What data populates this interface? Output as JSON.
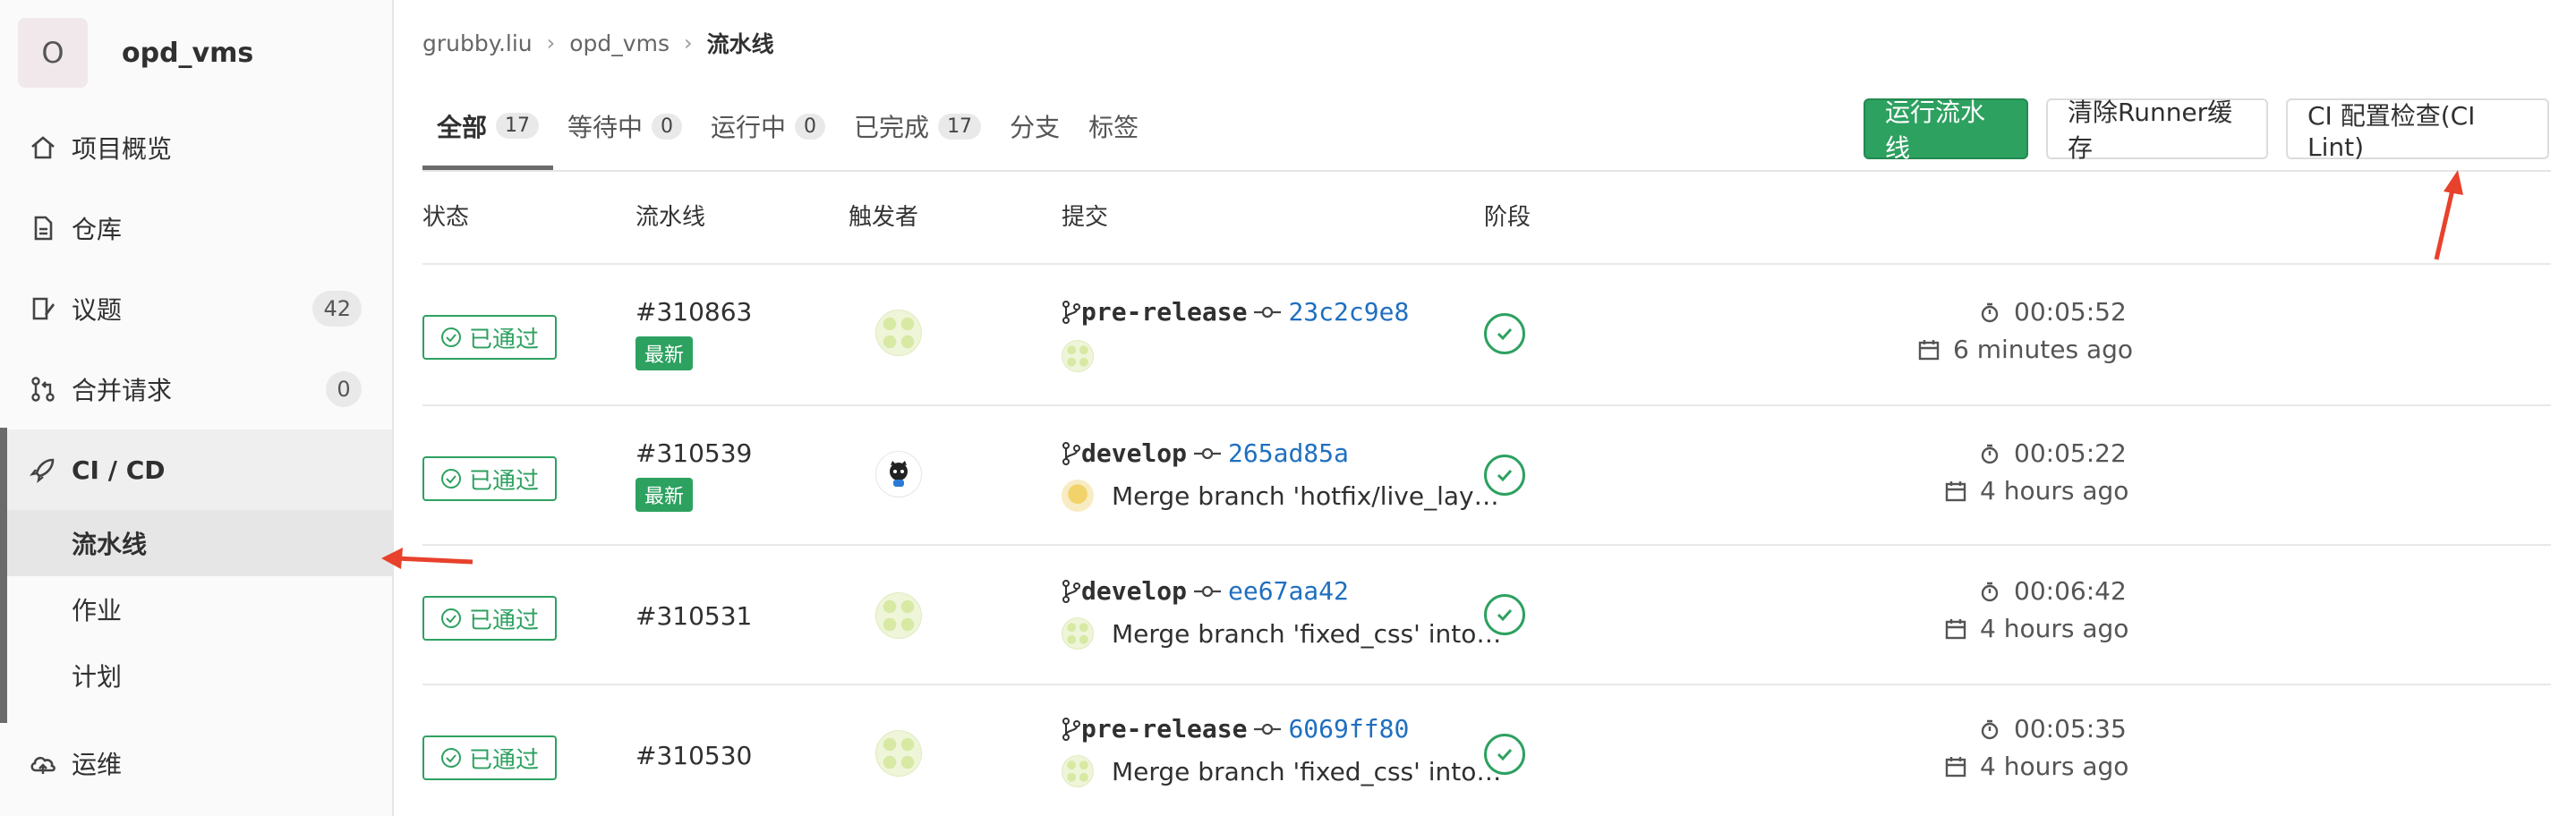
{
  "project": {
    "avatar_letter": "O",
    "name": "opd_vms"
  },
  "sidebar": {
    "items": [
      {
        "label": "项目概览",
        "icon": "home-icon"
      },
      {
        "label": "仓库",
        "icon": "document-icon"
      },
      {
        "label": "议题",
        "icon": "issues-icon",
        "badge": "42"
      },
      {
        "label": "合并请求",
        "icon": "merge-request-icon",
        "badge": "0"
      },
      {
        "label": "CI / CD",
        "icon": "rocket-icon"
      },
      {
        "label": "运维",
        "icon": "cloud-icon"
      }
    ],
    "ci_sub": [
      "流水线",
      "作业",
      "计划"
    ]
  },
  "breadcrumb": {
    "a": "grubby.liu",
    "b": "opd_vms",
    "c": "流水线"
  },
  "tabs": [
    {
      "label": "全部",
      "count": "17"
    },
    {
      "label": "等待中",
      "count": "0"
    },
    {
      "label": "运行中",
      "count": "0"
    },
    {
      "label": "已完成",
      "count": "17"
    },
    {
      "label": "分支"
    },
    {
      "label": "标签"
    }
  ],
  "buttons": {
    "run": "运行流水线",
    "clear": "清除Runner缓存",
    "lint": "CI 配置检查(CI Lint)"
  },
  "table": {
    "headers": {
      "status": "状态",
      "pipeline": "流水线",
      "trigger": "触发者",
      "commit": "提交",
      "stages": "阶段"
    },
    "rows": [
      {
        "status": "已通过",
        "id": "#310863",
        "latest": "最新",
        "ref": "pre-release",
        "sha": "23c2c9e8",
        "message": "",
        "duration": "00:05:52",
        "finished": "6 minutes ago"
      },
      {
        "status": "已通过",
        "id": "#310539",
        "latest": "最新",
        "ref": "develop",
        "sha": "265ad85a",
        "message": "Merge branch 'hotfix/live_lay…",
        "duration": "00:05:22",
        "finished": "4 hours ago"
      },
      {
        "status": "已通过",
        "id": "#310531",
        "ref": "develop",
        "sha": "ee67aa42",
        "message": "Merge branch 'fixed_css' into…",
        "duration": "00:06:42",
        "finished": "4 hours ago"
      },
      {
        "status": "已通过",
        "id": "#310530",
        "ref": "pre-release",
        "sha": "6069ff80",
        "message": "Merge branch 'fixed_css' into…",
        "duration": "00:05:35",
        "finished": "4 hours ago"
      }
    ]
  },
  "colors": {
    "success": "#2da160",
    "link": "#1f6fc0",
    "annotation": "#e8412c"
  }
}
